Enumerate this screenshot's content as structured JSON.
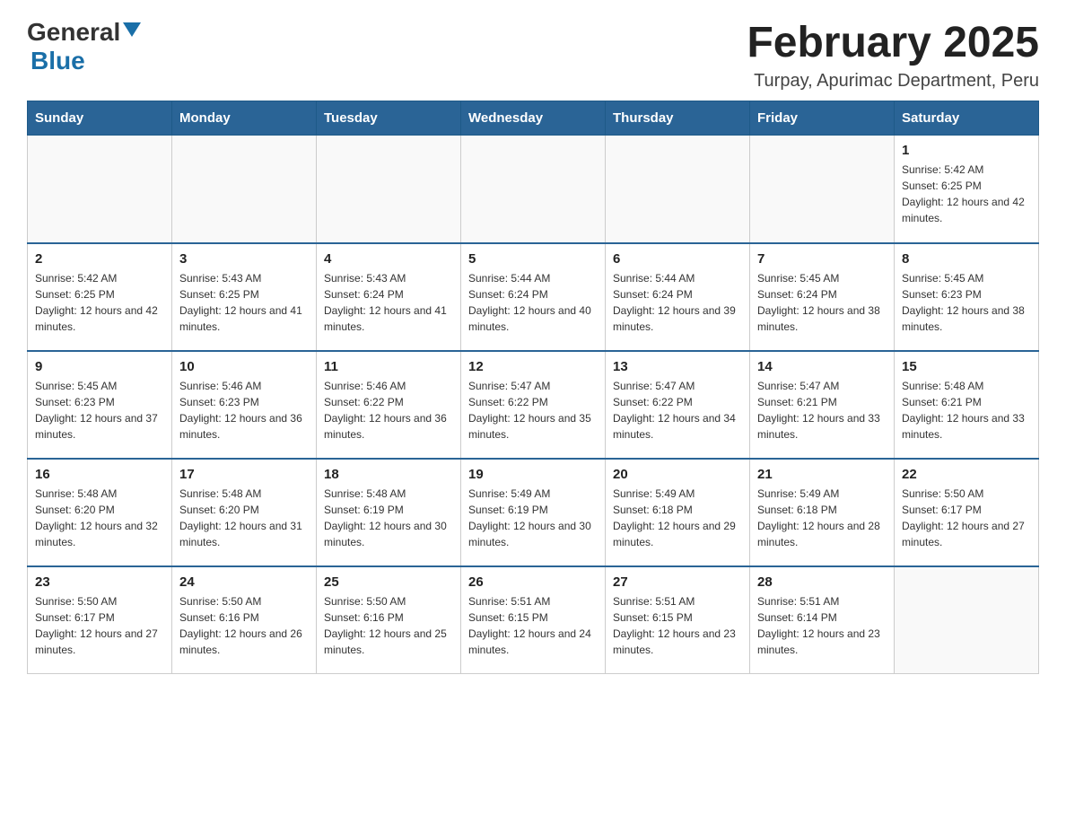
{
  "logo": {
    "general": "General",
    "blue": "Blue"
  },
  "title": "February 2025",
  "subtitle": "Turpay, Apurimac Department, Peru",
  "days_of_week": [
    "Sunday",
    "Monday",
    "Tuesday",
    "Wednesday",
    "Thursday",
    "Friday",
    "Saturday"
  ],
  "weeks": [
    [
      {
        "day": "",
        "info": ""
      },
      {
        "day": "",
        "info": ""
      },
      {
        "day": "",
        "info": ""
      },
      {
        "day": "",
        "info": ""
      },
      {
        "day": "",
        "info": ""
      },
      {
        "day": "",
        "info": ""
      },
      {
        "day": "1",
        "info": "Sunrise: 5:42 AM\nSunset: 6:25 PM\nDaylight: 12 hours and 42 minutes."
      }
    ],
    [
      {
        "day": "2",
        "info": "Sunrise: 5:42 AM\nSunset: 6:25 PM\nDaylight: 12 hours and 42 minutes."
      },
      {
        "day": "3",
        "info": "Sunrise: 5:43 AM\nSunset: 6:25 PM\nDaylight: 12 hours and 41 minutes."
      },
      {
        "day": "4",
        "info": "Sunrise: 5:43 AM\nSunset: 6:24 PM\nDaylight: 12 hours and 41 minutes."
      },
      {
        "day": "5",
        "info": "Sunrise: 5:44 AM\nSunset: 6:24 PM\nDaylight: 12 hours and 40 minutes."
      },
      {
        "day": "6",
        "info": "Sunrise: 5:44 AM\nSunset: 6:24 PM\nDaylight: 12 hours and 39 minutes."
      },
      {
        "day": "7",
        "info": "Sunrise: 5:45 AM\nSunset: 6:24 PM\nDaylight: 12 hours and 38 minutes."
      },
      {
        "day": "8",
        "info": "Sunrise: 5:45 AM\nSunset: 6:23 PM\nDaylight: 12 hours and 38 minutes."
      }
    ],
    [
      {
        "day": "9",
        "info": "Sunrise: 5:45 AM\nSunset: 6:23 PM\nDaylight: 12 hours and 37 minutes."
      },
      {
        "day": "10",
        "info": "Sunrise: 5:46 AM\nSunset: 6:23 PM\nDaylight: 12 hours and 36 minutes."
      },
      {
        "day": "11",
        "info": "Sunrise: 5:46 AM\nSunset: 6:22 PM\nDaylight: 12 hours and 36 minutes."
      },
      {
        "day": "12",
        "info": "Sunrise: 5:47 AM\nSunset: 6:22 PM\nDaylight: 12 hours and 35 minutes."
      },
      {
        "day": "13",
        "info": "Sunrise: 5:47 AM\nSunset: 6:22 PM\nDaylight: 12 hours and 34 minutes."
      },
      {
        "day": "14",
        "info": "Sunrise: 5:47 AM\nSunset: 6:21 PM\nDaylight: 12 hours and 33 minutes."
      },
      {
        "day": "15",
        "info": "Sunrise: 5:48 AM\nSunset: 6:21 PM\nDaylight: 12 hours and 33 minutes."
      }
    ],
    [
      {
        "day": "16",
        "info": "Sunrise: 5:48 AM\nSunset: 6:20 PM\nDaylight: 12 hours and 32 minutes."
      },
      {
        "day": "17",
        "info": "Sunrise: 5:48 AM\nSunset: 6:20 PM\nDaylight: 12 hours and 31 minutes."
      },
      {
        "day": "18",
        "info": "Sunrise: 5:48 AM\nSunset: 6:19 PM\nDaylight: 12 hours and 30 minutes."
      },
      {
        "day": "19",
        "info": "Sunrise: 5:49 AM\nSunset: 6:19 PM\nDaylight: 12 hours and 30 minutes."
      },
      {
        "day": "20",
        "info": "Sunrise: 5:49 AM\nSunset: 6:18 PM\nDaylight: 12 hours and 29 minutes."
      },
      {
        "day": "21",
        "info": "Sunrise: 5:49 AM\nSunset: 6:18 PM\nDaylight: 12 hours and 28 minutes."
      },
      {
        "day": "22",
        "info": "Sunrise: 5:50 AM\nSunset: 6:17 PM\nDaylight: 12 hours and 27 minutes."
      }
    ],
    [
      {
        "day": "23",
        "info": "Sunrise: 5:50 AM\nSunset: 6:17 PM\nDaylight: 12 hours and 27 minutes."
      },
      {
        "day": "24",
        "info": "Sunrise: 5:50 AM\nSunset: 6:16 PM\nDaylight: 12 hours and 26 minutes."
      },
      {
        "day": "25",
        "info": "Sunrise: 5:50 AM\nSunset: 6:16 PM\nDaylight: 12 hours and 25 minutes."
      },
      {
        "day": "26",
        "info": "Sunrise: 5:51 AM\nSunset: 6:15 PM\nDaylight: 12 hours and 24 minutes."
      },
      {
        "day": "27",
        "info": "Sunrise: 5:51 AM\nSunset: 6:15 PM\nDaylight: 12 hours and 23 minutes."
      },
      {
        "day": "28",
        "info": "Sunrise: 5:51 AM\nSunset: 6:14 PM\nDaylight: 12 hours and 23 minutes."
      },
      {
        "day": "",
        "info": ""
      }
    ]
  ],
  "colors": {
    "header_bg": "#2a6496",
    "header_text": "#ffffff",
    "border": "#cccccc",
    "text": "#333333"
  }
}
